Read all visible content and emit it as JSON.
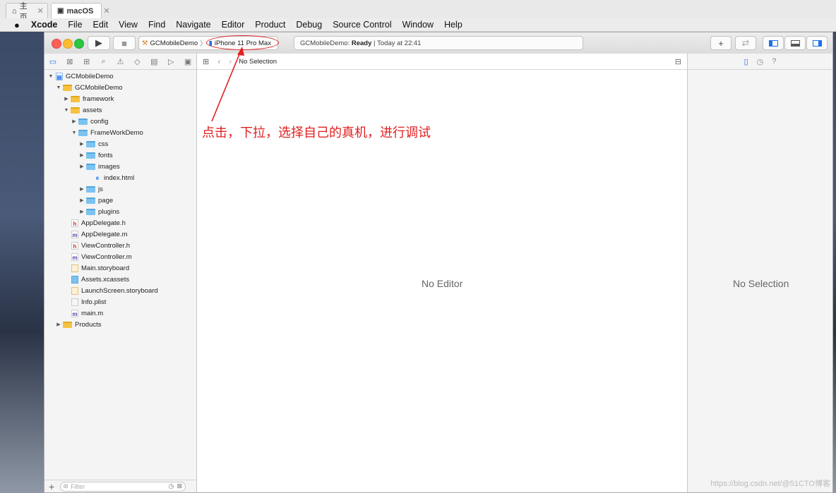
{
  "tabs": [
    {
      "label": "主页",
      "icon": "home-icon"
    },
    {
      "label": "macOS",
      "icon": "vm-icon"
    }
  ],
  "menubar": {
    "app": "Xcode",
    "items": [
      "File",
      "Edit",
      "View",
      "Find",
      "Navigate",
      "Editor",
      "Product",
      "Debug",
      "Source Control",
      "Window",
      "Help"
    ]
  },
  "toolbar": {
    "scheme": "GCMobileDemo",
    "device": "iPhone 11 Pro Max",
    "status_project": "GCMobileDemo:",
    "status_state": "Ready",
    "status_time": "Today at 22:41"
  },
  "navigator": {
    "items": [
      {
        "label": "GCMobileDemo",
        "type": "project"
      },
      {
        "label": "GCMobileDemo",
        "type": "group"
      },
      {
        "label": "framework",
        "type": "group"
      },
      {
        "label": "assets",
        "type": "group"
      },
      {
        "label": "config",
        "type": "folder"
      },
      {
        "label": "FrameWorkDemo",
        "type": "folder"
      },
      {
        "label": "css",
        "type": "folder"
      },
      {
        "label": "fonts",
        "type": "folder"
      },
      {
        "label": "images",
        "type": "folder"
      },
      {
        "label": "index.html",
        "type": "html"
      },
      {
        "label": "js",
        "type": "folder"
      },
      {
        "label": "page",
        "type": "folder"
      },
      {
        "label": "plugins",
        "type": "folder"
      },
      {
        "label": "AppDelegate.h",
        "type": "h"
      },
      {
        "label": "AppDelegate.m",
        "type": "m"
      },
      {
        "label": "ViewController.h",
        "type": "h"
      },
      {
        "label": "ViewController.m",
        "type": "m"
      },
      {
        "label": "Main.storyboard",
        "type": "storyboard"
      },
      {
        "label": "Assets.xcassets",
        "type": "assets"
      },
      {
        "label": "LaunchScreen.storyboard",
        "type": "storyboard"
      },
      {
        "label": "Info.plist",
        "type": "plist"
      },
      {
        "label": "main.m",
        "type": "m"
      },
      {
        "label": "Products",
        "type": "group"
      }
    ],
    "filter_placeholder": "Filter"
  },
  "editor": {
    "jump_label": "No Selection",
    "empty_message": "No Editor"
  },
  "inspector": {
    "empty_message": "No Selection"
  },
  "annotation": "点击，下拉，选择自己的真机，进行调试",
  "watermark": "https://blog.csdn.net/@51CTO博客",
  "colors": {
    "annotation": "#e02020",
    "accent": "#1a73e8",
    "folder_yellow": "#f5c242",
    "folder_blue": "#7cc3f0"
  }
}
